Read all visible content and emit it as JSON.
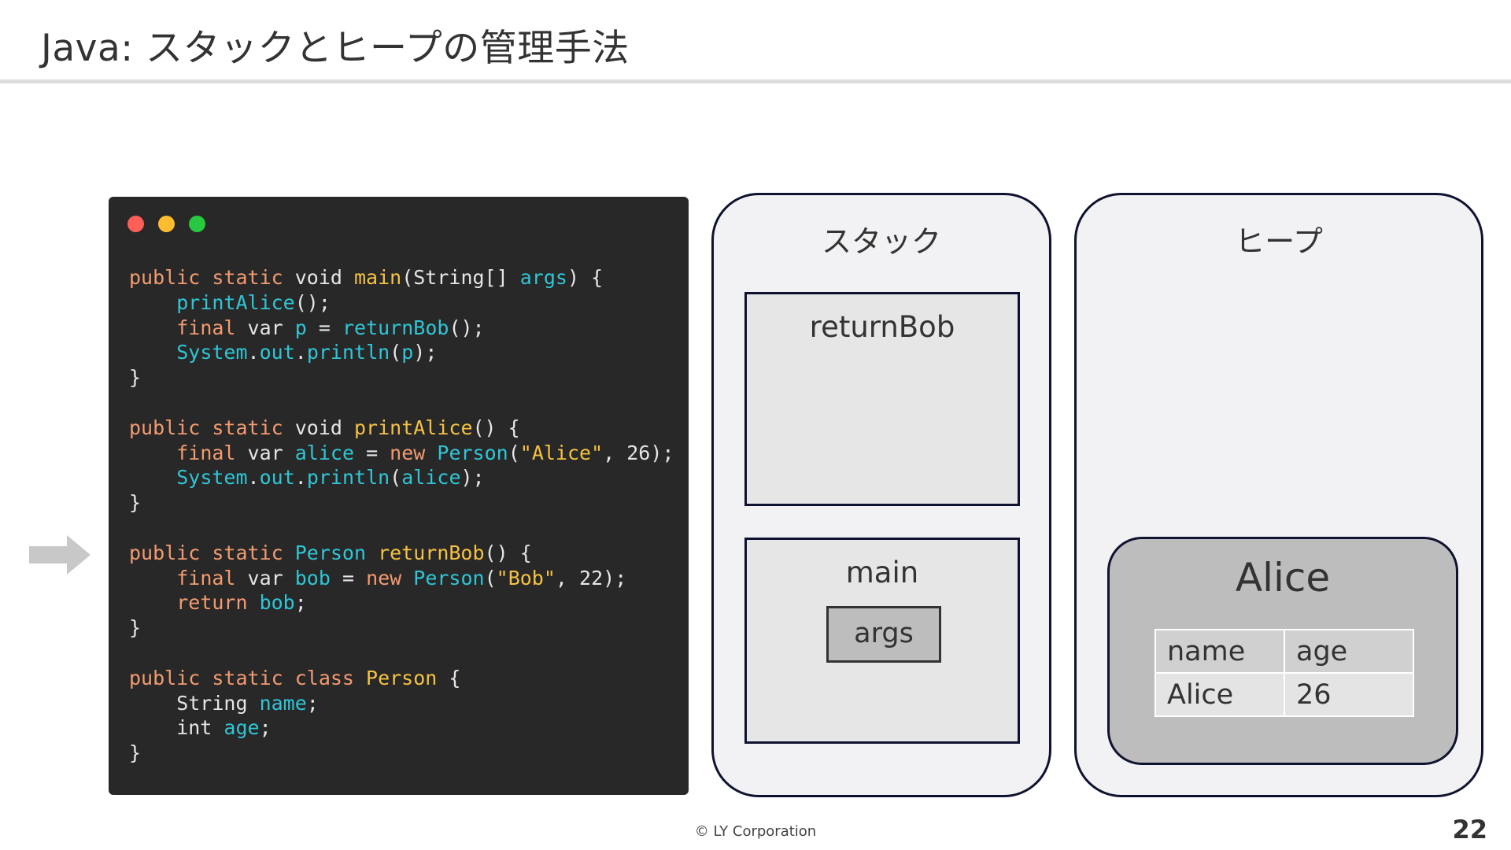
{
  "slide": {
    "title": "Java: スタックとヒープの管理手法",
    "footer": "© LY Corporation",
    "page_number": "22"
  },
  "code": {
    "lines": [
      [
        [
          "kw",
          "public static "
        ],
        [
          "p",
          "void "
        ],
        [
          "fn",
          "main"
        ],
        [
          "p",
          "(String[] "
        ],
        [
          "id",
          "args"
        ],
        [
          "p",
          ") {"
        ]
      ],
      [
        [
          "p",
          "    "
        ],
        [
          "id",
          "printAlice"
        ],
        [
          "p",
          "();"
        ]
      ],
      [
        [
          "p",
          "    "
        ],
        [
          "kw",
          "final "
        ],
        [
          "p",
          "var "
        ],
        [
          "id",
          "p"
        ],
        [
          "p",
          " = "
        ],
        [
          "id",
          "returnBob"
        ],
        [
          "p",
          "();"
        ]
      ],
      [
        [
          "p",
          "    "
        ],
        [
          "id",
          "System"
        ],
        [
          "p",
          "."
        ],
        [
          "id",
          "out"
        ],
        [
          "p",
          "."
        ],
        [
          "id",
          "println"
        ],
        [
          "p",
          "("
        ],
        [
          "id",
          "p"
        ],
        [
          "p",
          ");"
        ]
      ],
      [
        [
          "p",
          "}"
        ]
      ],
      [
        [
          "p",
          ""
        ]
      ],
      [
        [
          "kw",
          "public static "
        ],
        [
          "p",
          "void "
        ],
        [
          "fn",
          "printAlice"
        ],
        [
          "p",
          "() {"
        ]
      ],
      [
        [
          "p",
          "    "
        ],
        [
          "kw",
          "final "
        ],
        [
          "p",
          "var "
        ],
        [
          "id",
          "alice"
        ],
        [
          "p",
          " = "
        ],
        [
          "kw",
          "new "
        ],
        [
          "id",
          "Person"
        ],
        [
          "p",
          "("
        ],
        [
          "str",
          "\"Alice\""
        ],
        [
          "p",
          ", "
        ],
        [
          "num",
          "26"
        ],
        [
          "p",
          ");"
        ]
      ],
      [
        [
          "p",
          "    "
        ],
        [
          "id",
          "System"
        ],
        [
          "p",
          "."
        ],
        [
          "id",
          "out"
        ],
        [
          "p",
          "."
        ],
        [
          "id",
          "println"
        ],
        [
          "p",
          "("
        ],
        [
          "id",
          "alice"
        ],
        [
          "p",
          ");"
        ]
      ],
      [
        [
          "p",
          "}"
        ]
      ],
      [
        [
          "p",
          ""
        ]
      ],
      [
        [
          "kw",
          "public static "
        ],
        [
          "id",
          "Person "
        ],
        [
          "fn",
          "returnBob"
        ],
        [
          "p",
          "() {"
        ]
      ],
      [
        [
          "p",
          "    "
        ],
        [
          "kw",
          "final "
        ],
        [
          "p",
          "var "
        ],
        [
          "id",
          "bob"
        ],
        [
          "p",
          " = "
        ],
        [
          "kw",
          "new "
        ],
        [
          "id",
          "Person"
        ],
        [
          "p",
          "("
        ],
        [
          "str",
          "\"Bob\""
        ],
        [
          "p",
          ", "
        ],
        [
          "num",
          "22"
        ],
        [
          "p",
          ");"
        ]
      ],
      [
        [
          "p",
          "    "
        ],
        [
          "kw",
          "return "
        ],
        [
          "id",
          "bob"
        ],
        [
          "p",
          ";"
        ]
      ],
      [
        [
          "p",
          "}"
        ]
      ],
      [
        [
          "p",
          ""
        ]
      ],
      [
        [
          "kw",
          "public static class "
        ],
        [
          "fn",
          "Person"
        ],
        [
          "p",
          " {"
        ]
      ],
      [
        [
          "p",
          "    String "
        ],
        [
          "id",
          "name"
        ],
        [
          "p",
          ";"
        ]
      ],
      [
        [
          "p",
          "    int "
        ],
        [
          "id",
          "age"
        ],
        [
          "p",
          ";"
        ]
      ],
      [
        [
          "p",
          "}"
        ]
      ]
    ],
    "arrow_line_index": 11
  },
  "stack": {
    "title": "スタック",
    "frames": [
      {
        "label": "returnBob",
        "vars": []
      },
      {
        "label": "main",
        "vars": [
          "args"
        ]
      }
    ]
  },
  "heap": {
    "title": "ヒープ",
    "objects": [
      {
        "name": "Alice",
        "fields": {
          "headers": [
            "name",
            "age"
          ],
          "values": [
            "Alice",
            "26"
          ]
        }
      }
    ]
  },
  "colors": {
    "keyword": "#f39b70",
    "function": "#f5c242",
    "identifier": "#2fc6d6",
    "string": "#f5c242",
    "code_background": "#282828",
    "panel_border": "#0f1330"
  }
}
